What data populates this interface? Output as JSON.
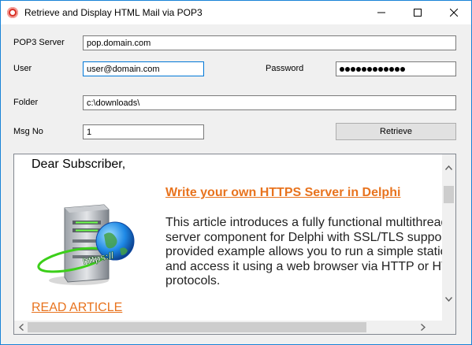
{
  "window": {
    "title": "Retrieve and Display HTML Mail via POP3"
  },
  "form": {
    "pop3_label": "POP3 Server",
    "pop3_value": "pop.domain.com",
    "user_label": "User",
    "user_value": "user@domain.com",
    "password_label": "Password",
    "password_length": 12,
    "folder_label": "Folder",
    "folder_value": "c:\\downloads\\",
    "msgno_label": "Msg No",
    "msgno_value": "1",
    "retrieve_label": "Retrieve"
  },
  "message": {
    "greeting": "Dear Subscriber,",
    "article_title": "Write your own HTTPS Server in Delphi",
    "article_lines": [
      "This article introduces a fully functional multithreaded",
      "server component for Delphi with SSL/TLS support",
      "provided example allows you to run a simple static",
      "and access it using a web browser via HTTP or HTTPS",
      "protocols."
    ],
    "read_more": "READ ARTICLE",
    "image_caption": "https://"
  },
  "colors": {
    "accent": "#e8731e",
    "window_border": "#1883d7",
    "focus_border": "#0078d7"
  },
  "icons": [
    "app-icon",
    "minimize-icon",
    "maximize-icon",
    "close-icon",
    "server-globe-image",
    "scroll-up-arrow-icon",
    "scroll-down-arrow-icon",
    "scroll-left-arrow-icon",
    "scroll-right-arrow-icon"
  ]
}
